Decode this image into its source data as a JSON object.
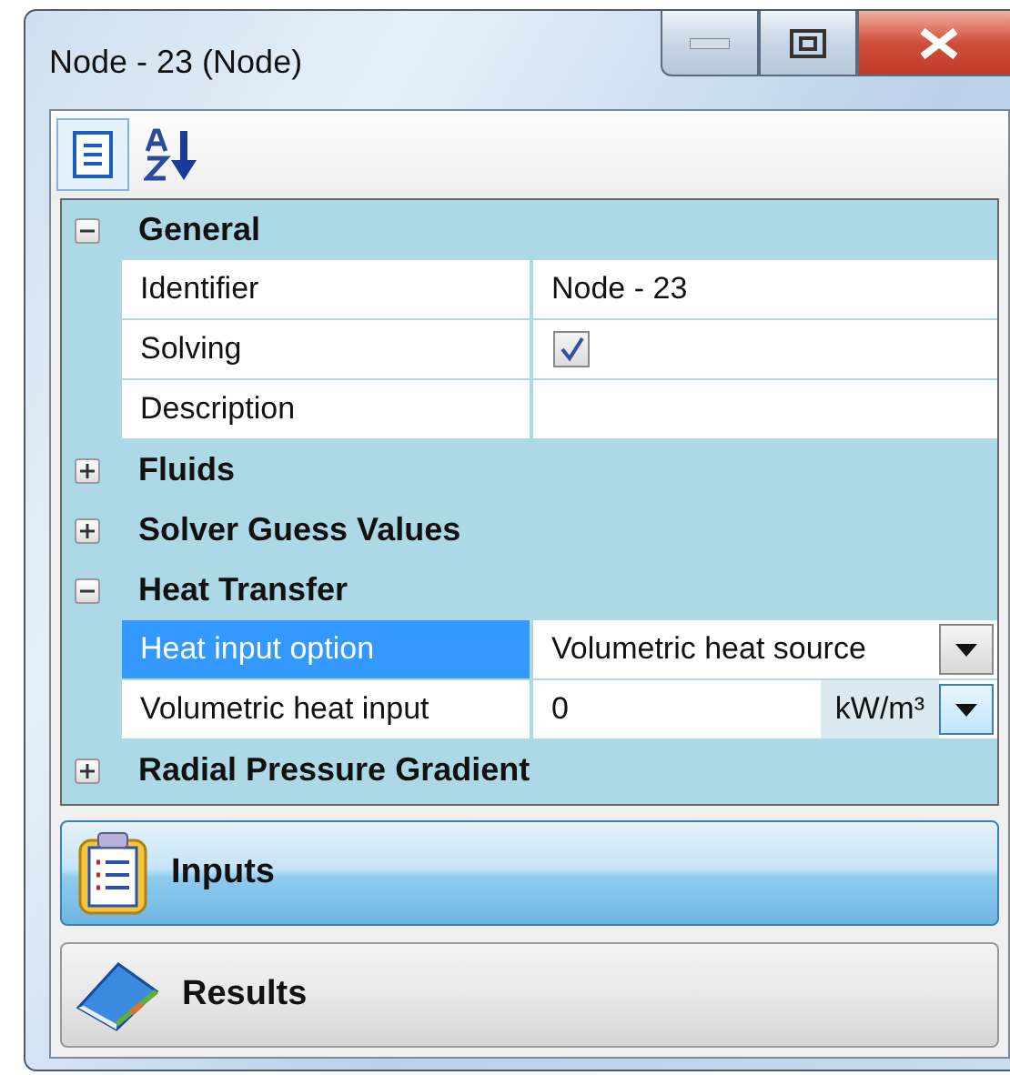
{
  "window": {
    "title": "Node - 23 (Node)"
  },
  "toolbar": [
    {
      "kind": "categorized",
      "selected": true
    },
    {
      "kind": "alphabetical",
      "selected": false
    }
  ],
  "categories": [
    {
      "name": "General",
      "expanded": true,
      "properties": [
        {
          "label": "Identifier",
          "kind": "text",
          "value": "Node - 23",
          "selected": false
        },
        {
          "label": "Solving",
          "kind": "checkbox",
          "checked": true,
          "selected": false
        },
        {
          "label": "Description",
          "kind": "text",
          "selected": false
        }
      ]
    },
    {
      "name": "Fluids",
      "expanded": false
    },
    {
      "name": "Solver Guess Values",
      "expanded": false
    },
    {
      "name": "Heat Transfer",
      "expanded": true,
      "properties": [
        {
          "label": "Heat input option",
          "kind": "dropdown",
          "value": "Volumetric heat source",
          "selected": true
        },
        {
          "label": "Volumetric heat input",
          "kind": "unit",
          "value": "0",
          "unit": "kW/m³",
          "selected": false
        }
      ]
    },
    {
      "name": "Radial Pressure Gradient",
      "expanded": false
    }
  ],
  "nav": [
    {
      "label": "Inputs",
      "kind": "clipboard",
      "selected": true
    },
    {
      "label": "Results",
      "kind": "book",
      "selected": false
    }
  ]
}
